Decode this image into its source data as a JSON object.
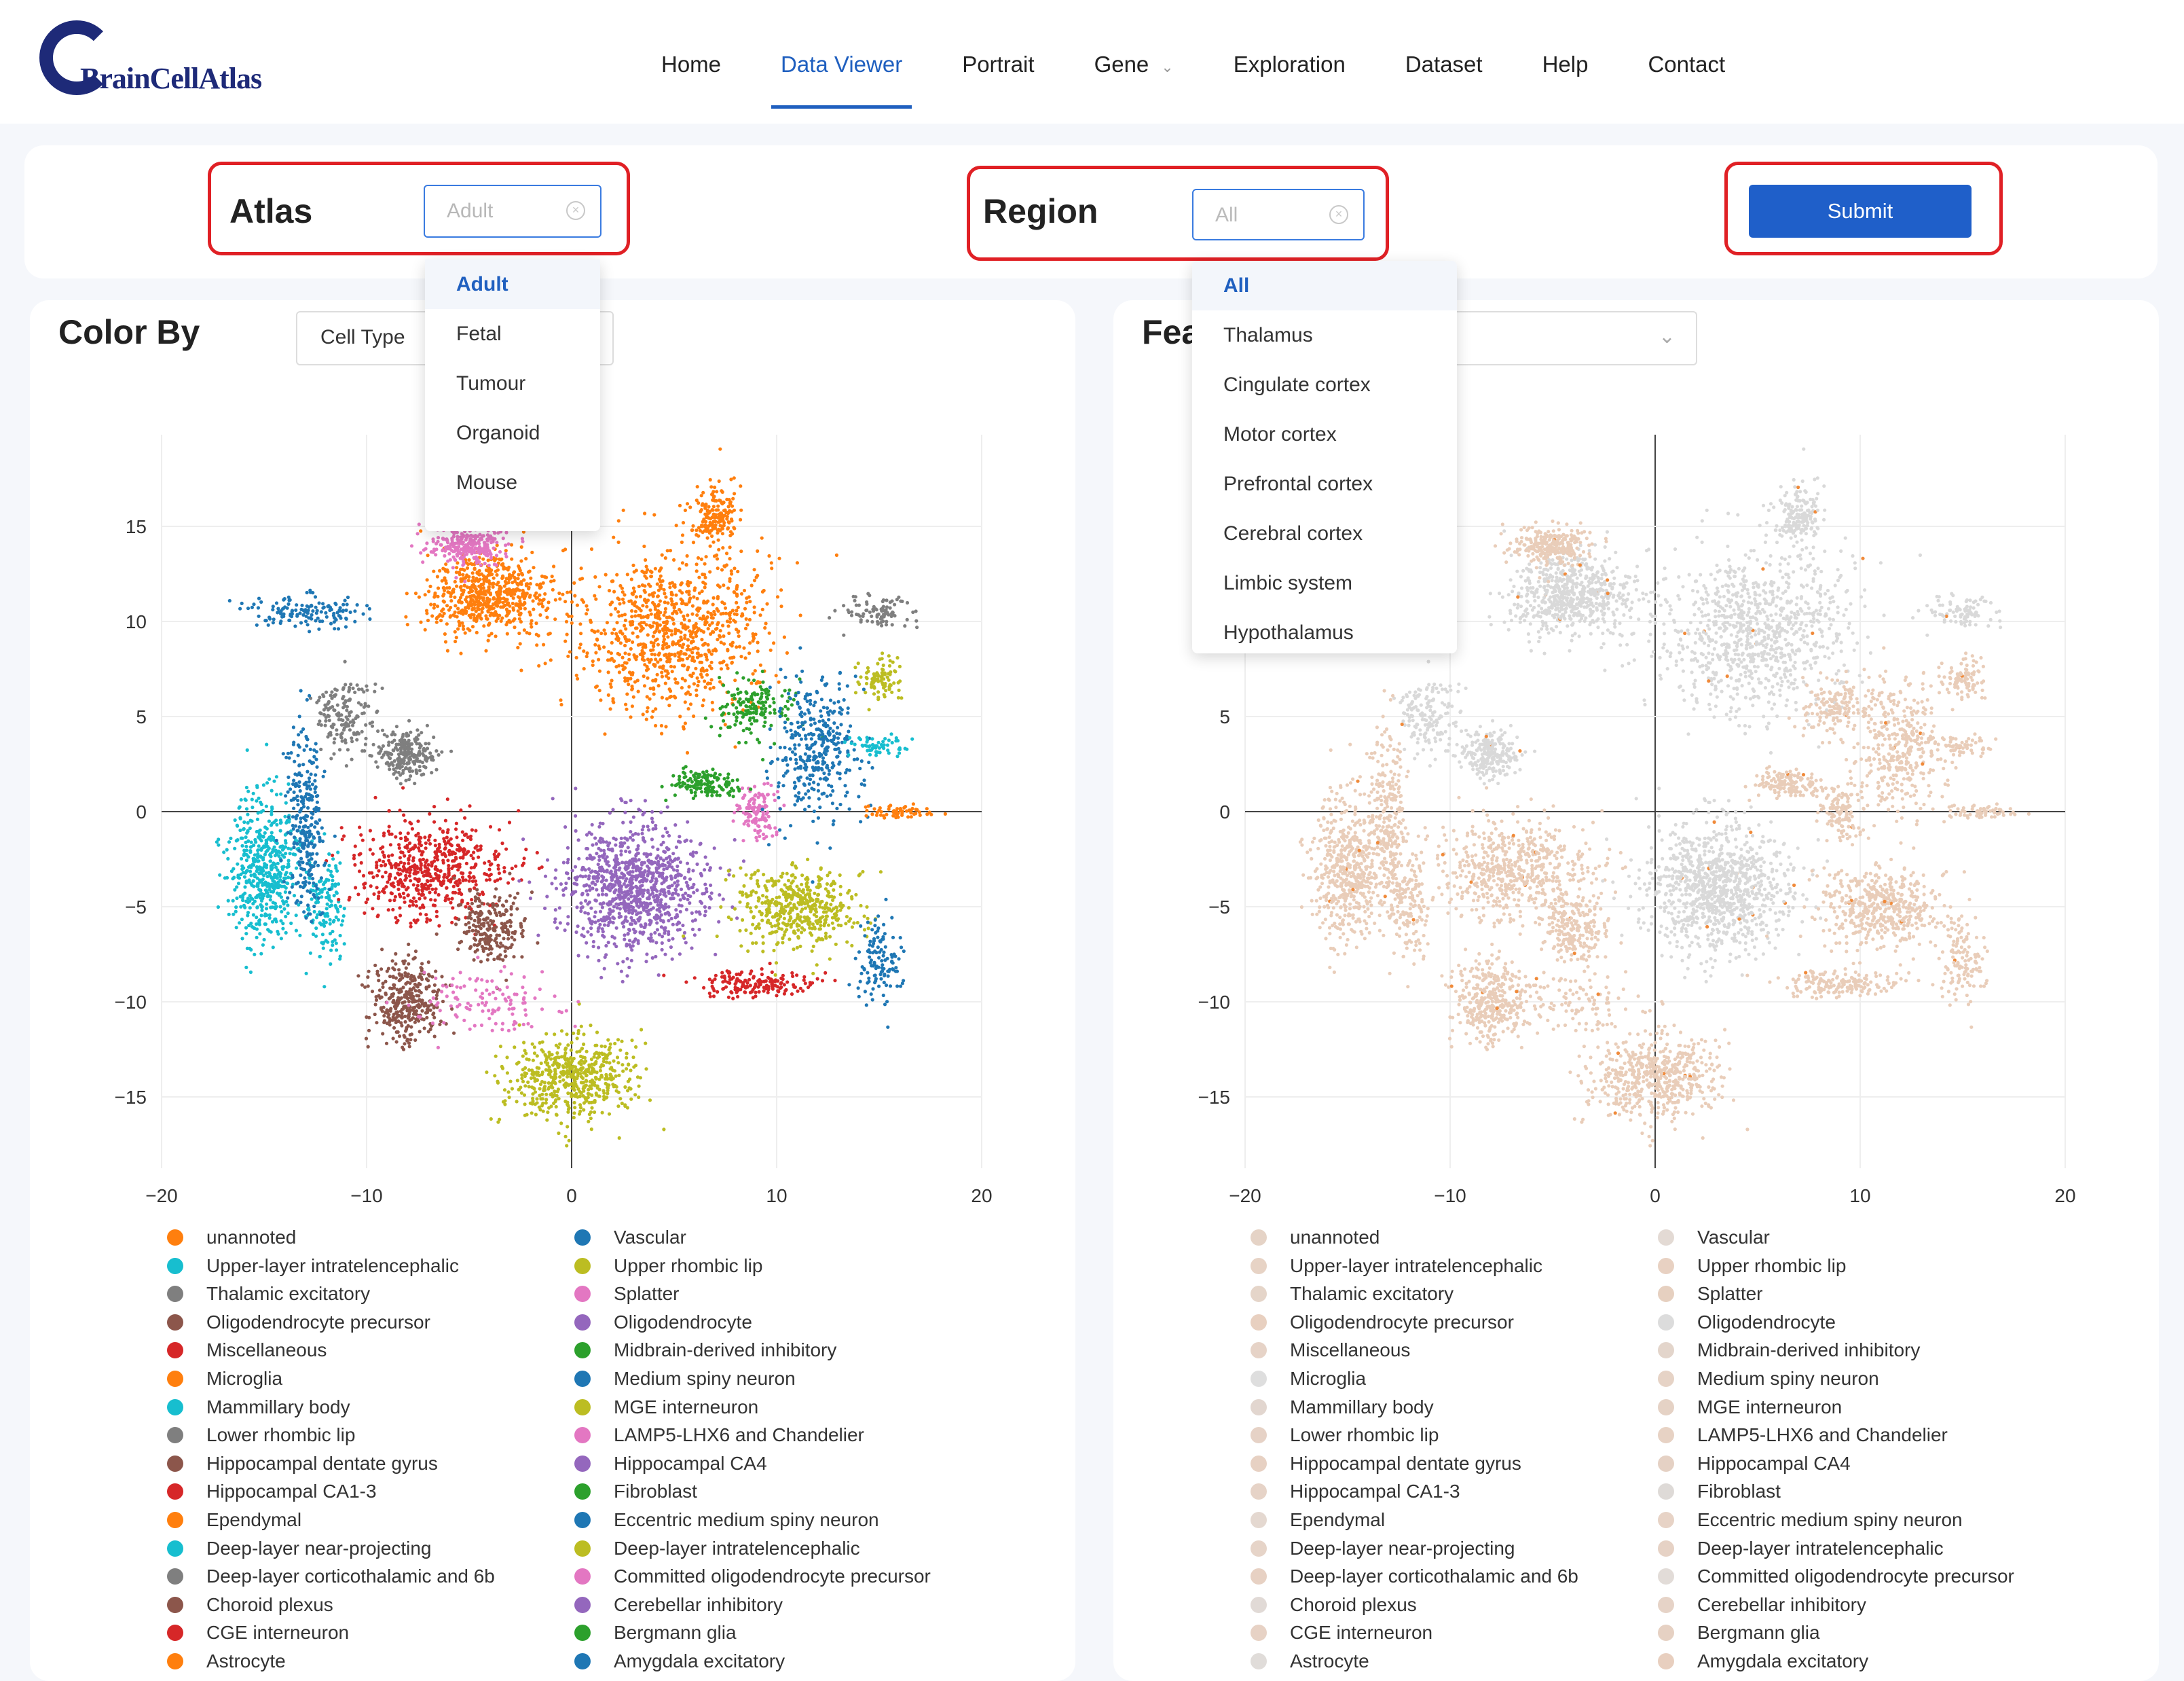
{
  "logo": {
    "text": "BrainCellAtlas"
  },
  "nav": [
    {
      "label": "Home"
    },
    {
      "label": "Data Viewer",
      "active": true
    },
    {
      "label": "Portrait"
    },
    {
      "label": "Gene",
      "dropdown": true
    },
    {
      "label": "Exploration"
    },
    {
      "label": "Dataset"
    },
    {
      "label": "Help"
    },
    {
      "label": "Contact"
    }
  ],
  "controls": {
    "atlas_label": "Atlas",
    "atlas_value": "Adult",
    "region_label": "Region",
    "region_value": "All",
    "submit_label": "Submit"
  },
  "atlas_options": [
    "Adult",
    "Fetal",
    "Tumour",
    "Organoid",
    "Mouse"
  ],
  "region_options": [
    "All",
    "Thalamus",
    "Cingulate cortex",
    "Motor cortex",
    "Prefrontal cortex",
    "Cerebral cortex",
    "Limbic system",
    "Hypothalamus"
  ],
  "left_panel": {
    "title": "Color By",
    "selector_value": "Cell Type"
  },
  "right_panel": {
    "title": "Fea"
  },
  "axes": {
    "x_ticks": [
      "−20",
      "−10",
      "0",
      "10",
      "20"
    ],
    "y_ticks": [
      "15",
      "10",
      "5",
      "0",
      "−5",
      "−10",
      "−15"
    ]
  },
  "colors": {
    "accent": "#1f5fbf",
    "highlight": "#e02025",
    "feature_low": "#d9d9d9",
    "feature_mid": "#e9cdb9",
    "feature_high": "#f08a3a"
  },
  "legend_left": [
    [
      "unannoted",
      "#ff7f0e"
    ],
    [
      "Upper-layer intratelencephalic",
      "#17becf"
    ],
    [
      "Thalamic excitatory",
      "#7f7f7f"
    ],
    [
      "Oligodendrocyte precursor",
      "#8c564b"
    ],
    [
      "Miscellaneous",
      "#d62728"
    ],
    [
      "Microglia",
      "#ff7f0e"
    ],
    [
      "Mammillary body",
      "#17becf"
    ],
    [
      "Lower rhombic lip",
      "#7f7f7f"
    ],
    [
      "Hippocampal dentate gyrus",
      "#8c564b"
    ],
    [
      "Hippocampal CA1-3",
      "#d62728"
    ],
    [
      "Ependymal",
      "#ff7f0e"
    ],
    [
      "Deep-layer near-projecting",
      "#17becf"
    ],
    [
      "Deep-layer corticothalamic and 6b",
      "#7f7f7f"
    ],
    [
      "Choroid plexus",
      "#8c564b"
    ],
    [
      "CGE interneuron",
      "#d62728"
    ],
    [
      "Astrocyte",
      "#ff7f0e"
    ]
  ],
  "legend_left2": [
    [
      "Vascular",
      "#1f77b4"
    ],
    [
      "Upper rhombic lip",
      "#bcbd22"
    ],
    [
      "Splatter",
      "#e377c2"
    ],
    [
      "Oligodendrocyte",
      "#9467bd"
    ],
    [
      "Midbrain-derived inhibitory",
      "#2ca02c"
    ],
    [
      "Medium spiny neuron",
      "#1f77b4"
    ],
    [
      "MGE interneuron",
      "#bcbd22"
    ],
    [
      "LAMP5-LHX6 and Chandelier",
      "#e377c2"
    ],
    [
      "Hippocampal CA4",
      "#9467bd"
    ],
    [
      "Fibroblast",
      "#2ca02c"
    ],
    [
      "Eccentric medium spiny neuron",
      "#1f77b4"
    ],
    [
      "Deep-layer intratelencephalic",
      "#bcbd22"
    ],
    [
      "Committed oligodendrocyte precursor",
      "#e377c2"
    ],
    [
      "Cerebellar inhibitory",
      "#9467bd"
    ],
    [
      "Bergmann glia",
      "#2ca02c"
    ],
    [
      "Amygdala excitatory",
      "#1f77b4"
    ]
  ],
  "legend_right_colors": [
    "#e5d3c6",
    "#e7d3c5",
    "#e5d5c9",
    "#e8d0c0",
    "#e6d3c7",
    "#dedede",
    "#e2d6cf",
    "#e6d2c6",
    "#e7d1c3",
    "#e6d3c7",
    "#e4d8d0",
    "#e6d4c8",
    "#e7d1c3",
    "#e1dad6",
    "#e7d2c5",
    "#e0dcd9"
  ],
  "legend_right2_colors": [
    "#e3dad4",
    "#e8d1c2",
    "#e6d0c0",
    "#dcdcdc",
    "#e3d5cb",
    "#e6d3c6",
    "#e5d2c5",
    "#e7d2c4",
    "#e5d1c4",
    "#dedad7",
    "#e7d3c6",
    "#e6d2c5",
    "#e2dcd8",
    "#e6d3c7",
    "#e6d1c3",
    "#e8cfbf"
  ]
}
